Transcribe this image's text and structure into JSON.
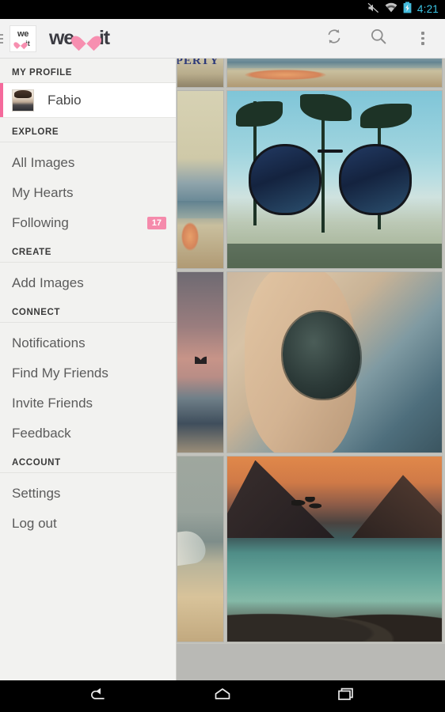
{
  "statusbar": {
    "time": "4:21",
    "icons": [
      "mute-icon",
      "wifi-icon",
      "battery-charging-icon"
    ]
  },
  "toolbar": {
    "drawer_icon": "hamburger-icon",
    "logo_we": "we",
    "logo_it": "it",
    "brand_we": "we",
    "brand_it": "it",
    "brand_heart": "heart-icon",
    "refresh_label": "refresh-icon",
    "search_label": "search-icon",
    "overflow_label": "overflow-menu-icon"
  },
  "drawer": {
    "sections": [
      {
        "header": "MY PROFILE",
        "profile": {
          "name": "Fabio",
          "selected": true
        }
      },
      {
        "header": "EXPLORE",
        "items": [
          {
            "label": "All Images",
            "badge": ""
          },
          {
            "label": "My Hearts",
            "badge": ""
          },
          {
            "label": "Following",
            "badge": "17"
          }
        ]
      },
      {
        "header": "CREATE",
        "items": [
          {
            "label": "Add Images",
            "badge": ""
          }
        ]
      },
      {
        "header": "CONNECT",
        "items": [
          {
            "label": "Notifications",
            "badge": ""
          },
          {
            "label": "Find My Friends",
            "badge": ""
          },
          {
            "label": "Invite Friends",
            "badge": ""
          },
          {
            "label": "Feedback",
            "badge": ""
          }
        ]
      },
      {
        "header": "ACCOUNT",
        "items": [
          {
            "label": "Settings",
            "badge": ""
          },
          {
            "label": "Log out",
            "badge": ""
          }
        ]
      }
    ]
  },
  "grid": {
    "left_column": [
      {
        "name": "liberty-sign-beach-photo"
      },
      {
        "name": "beach-umbrella-photo"
      },
      {
        "name": "sunset-seabird-photo"
      },
      {
        "name": "shoreline-photo"
      }
    ],
    "right_column": [
      {
        "name": "beach-shoreline-photo"
      },
      {
        "name": "sunglasses-palms-photo"
      },
      {
        "name": "baby-turtle-hand-photo"
      },
      {
        "name": "mountain-lake-photo"
      }
    ]
  },
  "navbar": {
    "back": "back-icon",
    "home": "home-icon",
    "recents": "recents-icon"
  },
  "colors": {
    "accent_pink": "#f58aab",
    "selection_pink": "#f56a9c",
    "toolbar_bg": "#f2f2f2",
    "drawer_bg": "#f2f2f0",
    "status_time": "#3cc6e6"
  }
}
